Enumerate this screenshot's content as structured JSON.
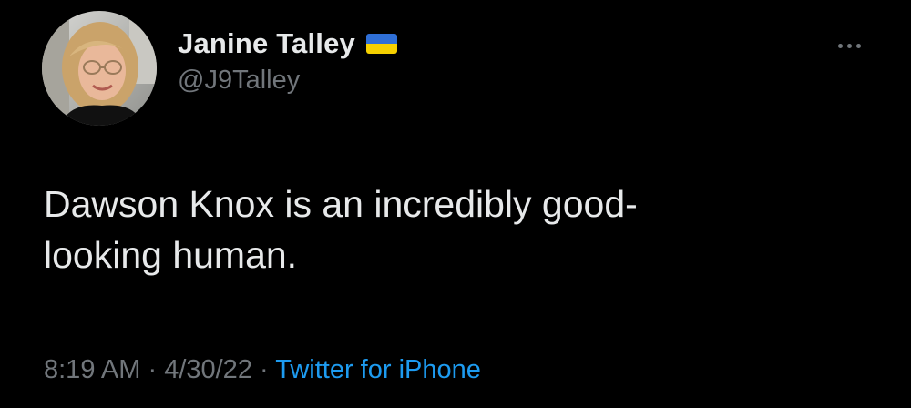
{
  "author": {
    "display_name": "Janine Talley",
    "handle": "@J9Talley",
    "badge": {
      "icon": "ukraine-flag-icon",
      "colors": [
        "#2f6fd6",
        "#f5d000"
      ]
    },
    "avatar_icon": "user-avatar"
  },
  "tweet": {
    "text": "Dawson Knox is an incredibly good-\nlooking human.",
    "time": "8:19 AM",
    "date": "4/30/22",
    "separator": "·",
    "source": "Twitter for iPhone"
  },
  "menu": {
    "icon": "more-options-icon"
  },
  "colors": {
    "background": "#000000",
    "primary_text": "#e7e9ea",
    "secondary_text": "#71767b",
    "link": "#1d9bf0"
  }
}
